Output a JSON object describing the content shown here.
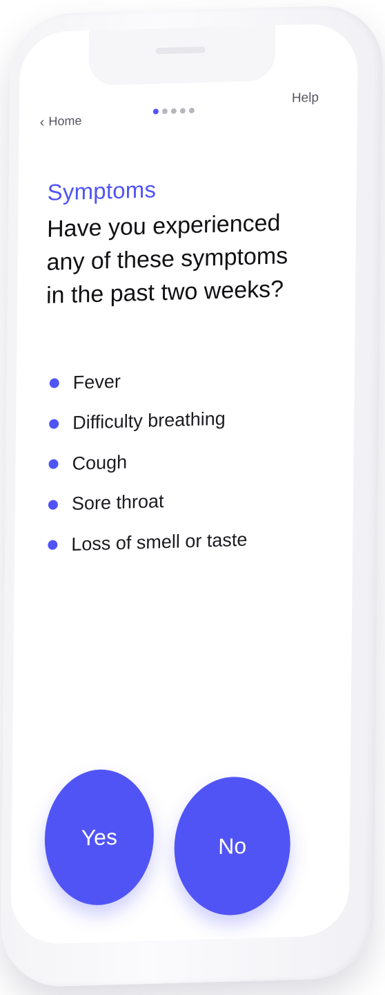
{
  "nav": {
    "back_label": "Home",
    "help_label": "Help",
    "progress": {
      "current_step": 1,
      "total_steps": 5
    }
  },
  "content": {
    "section_title": "Symptoms",
    "question": "Have you experienced\nany of these symptoms\nin the past two weeks?",
    "symptoms": [
      "Fever",
      "Difficulty breathing",
      "Cough",
      "Sore throat",
      "Loss of smell or taste"
    ]
  },
  "actions": {
    "yes_label": "Yes",
    "no_label": "No"
  },
  "colors": {
    "accent": "#5154f5",
    "text": "#111114",
    "muted": "#555560",
    "dot_inactive": "#b7b7c0"
  },
  "icons": {
    "back": "chevron-left-icon",
    "bullet": "dot-bullet-icon"
  }
}
